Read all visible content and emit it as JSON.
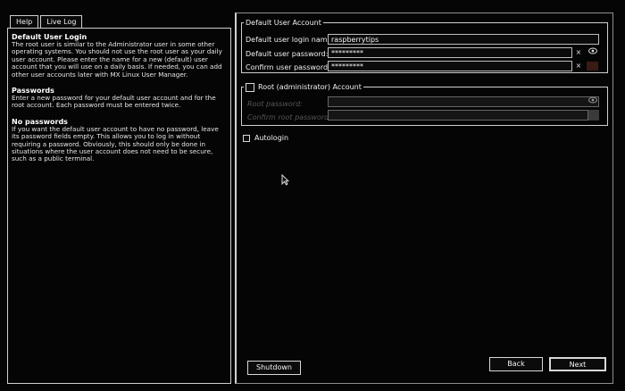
{
  "tabs": [
    {
      "label": "Help"
    },
    {
      "label": "Live Log"
    }
  ],
  "help": {
    "sections": [
      {
        "heading": "Default User Login",
        "body": "The root user is similar to the Administrator user in some other operating systems. You should not use the root user as your daily user account. Please enter the name for a new (default) user account that you will use on a daily basis. If needed, you can add other user accounts later with MX Linux User Manager."
      },
      {
        "heading": "Passwords",
        "body": "Enter a new password for your default user account and for the root account. Each password must be entered twice."
      },
      {
        "heading": "No passwords",
        "body": "If you want the default user account to have no password, leave its password fields empty. This allows you to log in without requiring a password. Obviously, this should only be done in situations where the user account does not need to be secure, such as a public terminal."
      }
    ]
  },
  "default_user": {
    "legend": "Default User Account",
    "login_label": "Default user login name:",
    "login_value": "raspberrytips",
    "password_label": "Default user password:",
    "password_value": "*********",
    "confirm_label": "Confirm user password:",
    "confirm_value": "*********"
  },
  "root_account": {
    "legend": "Root (administrator) Account",
    "checked": false,
    "password_label": "Root password:",
    "confirm_label": "Confirm root password:"
  },
  "autologin": {
    "label": "Autologin",
    "checked": false
  },
  "buttons": {
    "shutdown": "Shutdown",
    "back": "Back",
    "next": "Next"
  },
  "icons": {
    "clear": "×",
    "reveal": "👁"
  }
}
